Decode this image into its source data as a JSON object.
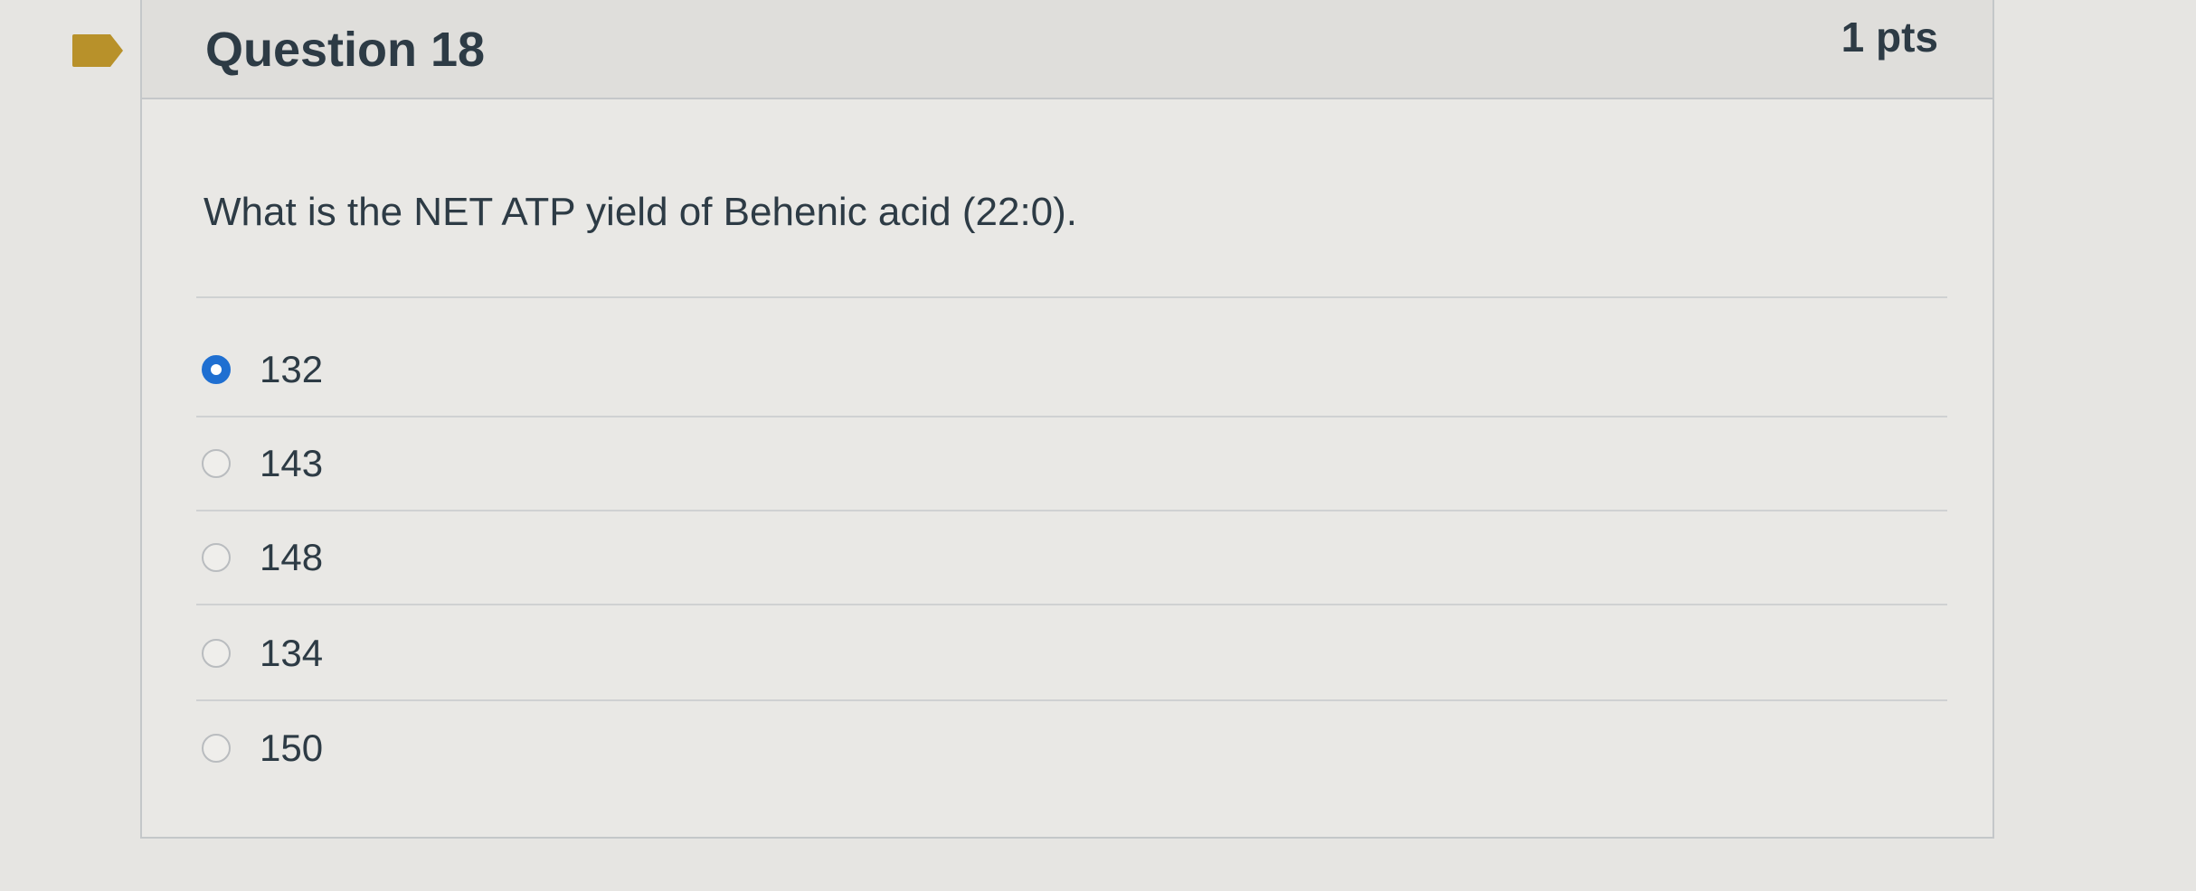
{
  "question": {
    "title": "Question 18",
    "points": "1 pts",
    "text": "What is the NET ATP yield of Behenic acid (22:0).",
    "flag_icon": "bookmark-flag-icon",
    "flag_color": "#b8912a"
  },
  "answers": [
    {
      "label": "132",
      "selected": true
    },
    {
      "label": "143",
      "selected": false
    },
    {
      "label": "148",
      "selected": false
    },
    {
      "label": "134",
      "selected": false
    },
    {
      "label": "150",
      "selected": false
    }
  ],
  "colors": {
    "radio_selected": "#1f6fd1",
    "text": "#2d3b45"
  }
}
